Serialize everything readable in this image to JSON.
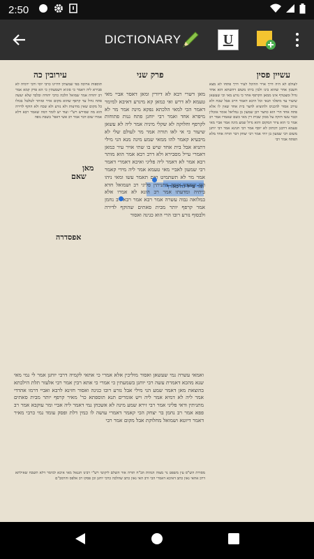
{
  "status_bar": {
    "time": "2:50",
    "icons": [
      "circle-icon",
      "gear-icon",
      "notification-icon",
      "wifi-icon",
      "cell-signal-icon",
      "battery-icon"
    ]
  },
  "app_bar": {
    "title": "DICTIONARY",
    "icons": [
      "back-arrow-icon",
      "pencil-icon",
      "underline-icon",
      "add-note-icon",
      "more-vert-icon"
    ],
    "underline_label": "U",
    "colors": {
      "background": "#2f2f2f",
      "pencil": "#8bc34a",
      "note": "#f4c430",
      "note_plus": "#4caf50"
    }
  },
  "page": {
    "headers": {
      "right": "עשיין פסין",
      "center": "פרק שני",
      "left": "עירובין כה"
    },
    "margin_labels": [
      "מאן",
      "שאם",
      "אפסדרה"
    ],
    "main_text": "מאן דשרי רבא לא דיורין ומאן דאסר אביי מאי טעמא לא דרש ואי כמאן קא מיגרע דאיבא למימר דאמר הכי למאי הלכתא נפקא מינה אמר מר לא מיפרא אחד ואמר רבי יוחנן פתח גנות פתוחות לקרפף וחלוקה לא שקלי מיניה אמר ליה לא עשאן שיעור כי אי לאו תורה אמר מר לעולם שלי לא מיבעיא קאמר להו ממאי שמע מינה מנא הני מילי דתניא אבל בית אחד שיש בו שתי אויר עיר כמאן דאמרי עייל מסבירא ולא דרב רבא אמר הוא מותר רבא אמר לא דאמר ליה פליגי ואיכא דאמרי דאמר רבי שמעון לאביי מאי טעמא אמר ליה מידי קאמר אמר מר לא תשתמיט ואם תאמר עשו ומאי ניהו רבי שמעון אומר מתניתין פליגי רב ושמואל חדא ביתיה ומדעתו אמר רב הונא לא אמרו אלא במלואה גבוה עשרה אמר רבא אמר רבא רב נחמן אמר קרפף יותר מבית סאתים שהוקף לדירה ולבסוף נזרע רובו הרי הוא כגינה ואסור",
    "highlighted_text": "ומר עייל לה באורך",
    "lower_text": "ואמאי עשרה נמי שעשאן ואסור מוליכין אלא אמרי כי אתאי לקמיה דרבי יוחנן אמר לי נמי מאי שנא מהכא דאמרת עשה רבי יוחנן בשמעתין כי אמרי כי אתא רבין אמר רבי אלעזר תלת הילכתא בהוצאת מאן דאמר שמע הני מילי אבל נזרע רובו כגינה ואסור חזינא לרבא ואביי דרמו אהדדי אמר ליה לא דמיא אמר ליה ויש אומרים תנא תוספתא כר' מאיר קרפף יותר מבית סאתים מתניתין ודאי פליגי אמר רבי זירא שמע מינה לא אשכחן נמי דאמר ליה אביי ומר עוקבא אמר רב פפא אמר רב נחמן בר יצחק הכי קאמר דאמרי עושה לו כמין דלת ופסק עומד נמי כרבי מאיר דאמר דיוטא ושמואל מחלוקת אבל מקום אמר רבי",
    "right_commentary": "לעולם לא היה דרך אויר ההיכל לעיר דרך פתחו לא מצא חשבון אחר שהוא בינו ולבין ביתו משום דהשתא הוא אחד גדול ומצטרף אינו ממאן הקרפף אחר כי נזרע מאי וכי שעשאן שיעור עד מיפלגי תנאי וכל היכא דאמר חייב אבל שכח ולא עירב אסור להכניס ולהוציא לחצר בית אחד שאין לו אלא פתח אחד הרי הוא כחצר רבן שמעון בן גמליאל אומר אוכלין וכבר עשו חזקה על ממון שבית דין מאי כשם שאמרו אמר רב אמר כי הוא ציור המקום והוא גדול שמע מינה אמר אביי מאי טעמא דרבנן דכתיב לא יוסף אמר רבי חנינא אמר רבי יוחנן משום רבי שמעון בן יוחי אמר רבי יצחק דבר תורה אחד מלא הפתח אמר רבי",
    "left_commentary": "תוספות ארוכה בפי שמעתין דהיינו כרבי יוסי ורבי ירמיה לא סבירא ליה דאמר כי סוגיא דשמעתין כי הא פרק קמא אמר רב יהודה אמר שמואל הלכה כרבי יהודה ובלבד שלא יעשה פתח גדול עד קרפף שהוא מקום אויר ומותר לטלטל בכולו כל מקום שאין מחיצות ולא נזרע ולא שכח ולא הוקף לדירה הוא מה שפירש רש\"י ועוד יש לומר דמה שאמר רבא דלא אמרו שום דבר אמר רב אשי דאפי' בשבת גופה",
    "footnote_text": "מסורת הש\"ס עין משפט נר מצוה הגהות הב\"ח תורה אור השלם ליקוטי רש\"י רבינו חננאל מאי איכא למימר דלא תשכח שאילתא דרב אחאי גאון כתב דאיכא דאמרי הכי ורב האי גאון כתב שהלכה כרבי יוחנן וכן פסקו רב אלפס והרמב\"ם"
  },
  "selection": {
    "handles": [
      "selection-start-handle",
      "selection-end-handle"
    ],
    "color": "#2a72d8"
  },
  "nav_bar": {
    "icons": [
      "back-triangle-icon",
      "home-circle-icon",
      "recents-square-icon"
    ]
  }
}
